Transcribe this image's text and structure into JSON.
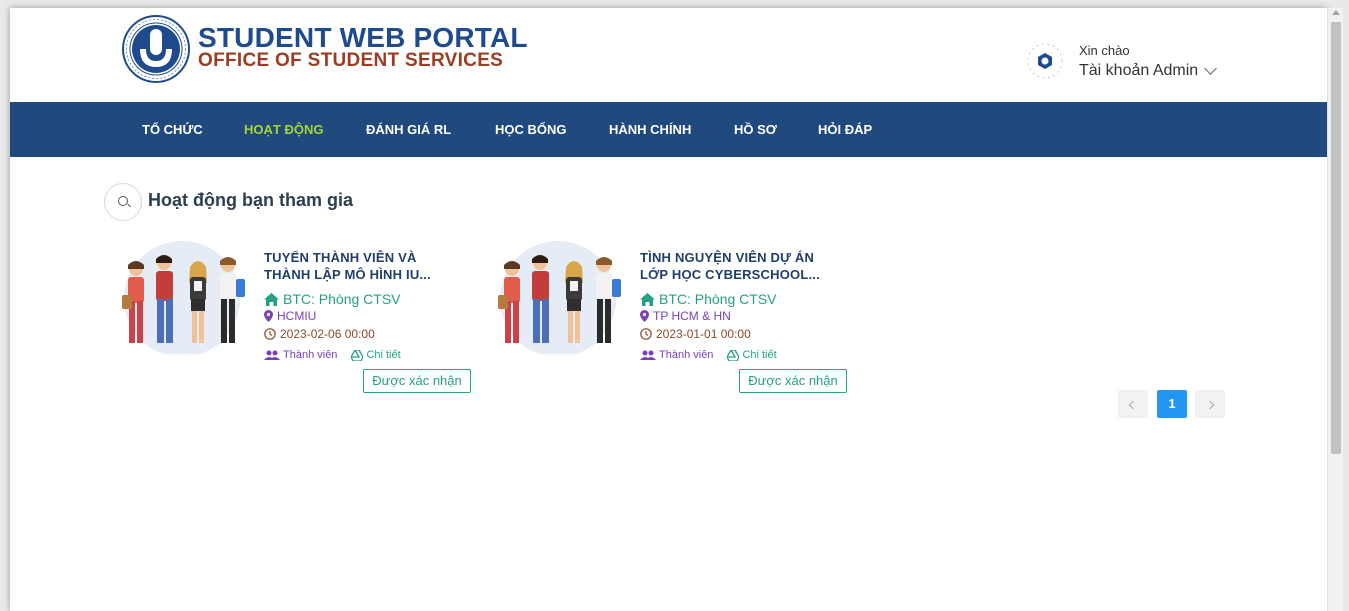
{
  "header": {
    "brand_title": "STUDENT WEB PORTAL",
    "brand_subtitle": "OFFICE OF STUDENT SERVICES",
    "greeting": "Xin chào",
    "account_label": "Tài khoản Admin"
  },
  "nav": {
    "items": [
      "TỔ CHỨC",
      "HOẠT ĐỘNG",
      "ĐÁNH GIÁ RL",
      "HỌC BỔNG",
      "HÀNH CHÍNH",
      "HỒ SƠ",
      "HỎI ĐÁP"
    ],
    "active_index": 1
  },
  "section": {
    "title": "Hoạt động bạn tham gia"
  },
  "activities": [
    {
      "title_line1": "TUYỂN THÀNH VIÊN VÀ",
      "title_line2": "THÀNH LẬP MÔ HÌNH IU...",
      "org": "BTC:  Phòng CTSV",
      "location": "HCMIU",
      "datetime": "2023-02-06 00:00",
      "members_label": "Thành viên",
      "details_label": "Chi tiết",
      "status": "Được xác nhận"
    },
    {
      "title_line1": "TÌNH NGUYỆN VIÊN DỰ ÁN",
      "title_line2": "LỚP HỌC CYBERSCHOOL...",
      "org": "BTC:  Phòng CTSV",
      "location": "TP HCM & HN",
      "datetime": "2023-01-01 00:00",
      "members_label": "Thành viên",
      "details_label": "Chi tiết",
      "status": "Được xác nhận"
    }
  ],
  "pagination": {
    "current_page": "1"
  },
  "colors": {
    "nav_bg": "#20497e",
    "nav_active": "#a5d43a",
    "brand_blue": "#1f4b8e",
    "brand_red": "#9c3d22",
    "teal": "#26a085",
    "purple": "#7a3fb5",
    "page_active": "#2196f3"
  },
  "icons": [
    "university-seal-logo",
    "user-avatar-gear-icon",
    "chevron-down-icon",
    "search-icon",
    "home-icon",
    "map-pin-icon",
    "clock-icon",
    "users-icon",
    "drive-icon",
    "chevron-left-icon",
    "chevron-right-icon"
  ]
}
